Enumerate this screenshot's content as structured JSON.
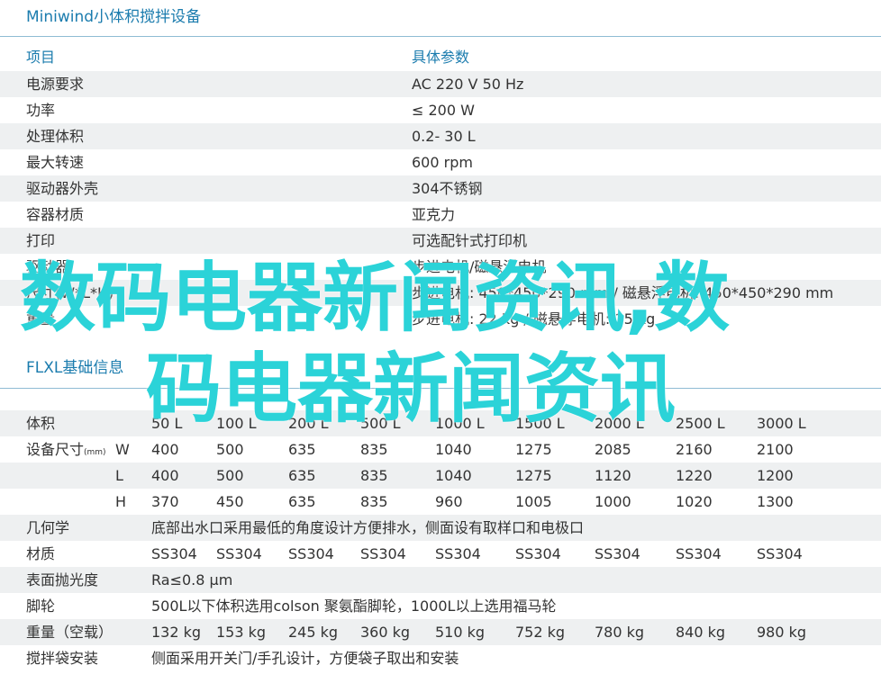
{
  "table1": {
    "title": "Miniwind小体积搅拌设备",
    "header": {
      "key": "项目",
      "value": "具体参数"
    },
    "rows": [
      {
        "key": "电源要求",
        "value": "AC 220 V 50 Hz"
      },
      {
        "key": "功率",
        "value": "≤ 200 W"
      },
      {
        "key": "处理体积",
        "value": "0.2- 30 L"
      },
      {
        "key": "最大转速",
        "value": "600 rpm"
      },
      {
        "key": "驱动器外壳",
        "value": "304不锈钢"
      },
      {
        "key": "容器材质",
        "value": "亚克力"
      },
      {
        "key": "打印",
        "value": "可选配针式打印机"
      },
      {
        "key": "驱动器",
        "value": "步进电机/磁悬浮电机"
      },
      {
        "key": "尺寸(W*L*H)",
        "value": "步进电机: 450*450*290 mm / 磁悬浮电机: 450*450*290 mm"
      },
      {
        "key": "重量",
        "value": "步进电机: 22 kg / 磁悬浮电机: 15 kg"
      }
    ]
  },
  "table2": {
    "title": "FLXL基础信息",
    "columns": [
      "体积",
      "50 L",
      "100 L",
      "200 L",
      "500 L",
      "1000 L",
      "1500 L",
      "2000 L",
      "2500 L",
      "3000 L"
    ],
    "size": {
      "label": "设备尺寸",
      "unit": "(mm)",
      "rows": [
        {
          "axis": "W",
          "values": [
            "400",
            "500",
            "635",
            "835",
            "1040",
            "1275",
            "2085",
            "2160",
            "2100"
          ]
        },
        {
          "axis": "L",
          "values": [
            "400",
            "500",
            "635",
            "835",
            "1040",
            "1275",
            "1120",
            "1220",
            "1200"
          ]
        },
        {
          "axis": "H",
          "values": [
            "370",
            "450",
            "635",
            "835",
            "960",
            "1005",
            "1000",
            "1020",
            "1300"
          ]
        }
      ]
    },
    "geometry": {
      "label": "几何学",
      "value": "底部出水口采用最低的角度设计方便排水，侧面设有取样口和电极口"
    },
    "material": {
      "label": "材质",
      "values": [
        "SS304",
        "SS304",
        "SS304",
        "SS304",
        "SS304",
        "SS304",
        "SS304",
        "SS304",
        "SS304"
      ]
    },
    "polish": {
      "label": "表面抛光度",
      "value": "Ra≤0.8 μm"
    },
    "wheels": {
      "label": "脚轮",
      "value": "500L以下体积选用colson 聚氨酯脚轮，1000L以上选用福马轮"
    },
    "weight": {
      "label": "重量（空载）",
      "values": [
        "132 kg",
        "153 kg",
        "245 kg",
        "360 kg",
        "510 kg",
        "752 kg",
        "780 kg",
        "840 kg",
        "980 kg"
      ]
    },
    "bag": {
      "label": "搅拌袋安装",
      "value": "侧面采用开关门/手孔设计，方便袋子取出和安装"
    }
  },
  "watermark": {
    "line1": "数码电器新闻资讯,数",
    "line2": "码电器新闻资讯"
  }
}
